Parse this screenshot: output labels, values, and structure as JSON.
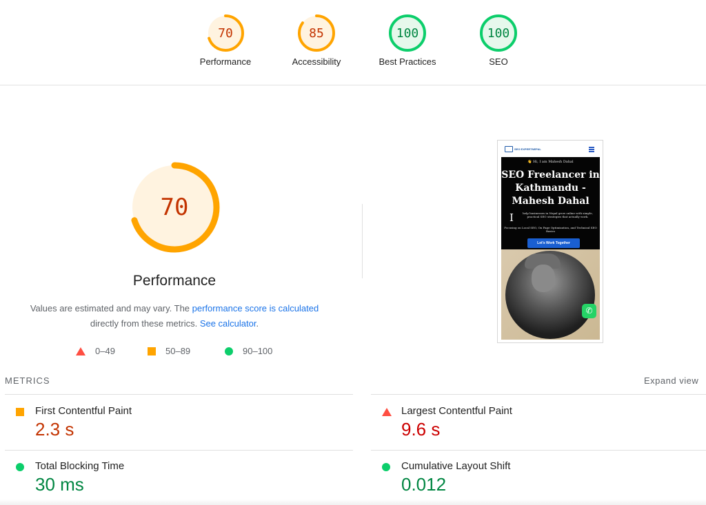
{
  "colors": {
    "average": "#ffa400",
    "average_text": "#c33300",
    "average_bg": "#fff3e0",
    "pass": "#0cce6b",
    "pass_text": "#018642",
    "pass_bg": "#e6f8ec",
    "fail": "#ff4e42",
    "fail_text": "#cc0000",
    "link": "#1a73e8"
  },
  "categories": [
    {
      "label": "Performance",
      "score": "70",
      "score_value": 70,
      "rating": "average"
    },
    {
      "label": "Accessibility",
      "score": "85",
      "score_value": 85,
      "rating": "average"
    },
    {
      "label": "Best Practices",
      "score": "100",
      "score_value": 100,
      "rating": "pass"
    },
    {
      "label": "SEO",
      "score": "100",
      "score_value": 100,
      "rating": "pass"
    }
  ],
  "performance": {
    "score": "70",
    "score_value": 70,
    "title": "Performance",
    "desc_pre": "Values are estimated and may vary. The ",
    "desc_link1": "performance score is calculated",
    "desc_mid": " directly from these metrics. ",
    "desc_link2": "See calculator",
    "desc_post": "."
  },
  "legend": [
    {
      "shape": "triangle-icon",
      "label": "0–49"
    },
    {
      "shape": "square-icon",
      "label": "50–89"
    },
    {
      "shape": "circle-icon",
      "label": "90–100"
    }
  ],
  "screenshot": {
    "logo_text": "SEO EXPERTNEPAL",
    "greeting": "👋 Hi, I am Mahesh Dahal",
    "headline": "SEO Freelancer in Kathmandu - Mahesh Dahal",
    "big_letter": "I",
    "intro": "help businesses in Nepal grow online with simple, practical SEO strategies that actually work.",
    "focus": "Focusing on Local SEO, On Page Optimization, and Technical SEO Basics",
    "cta": "Let's Work Together",
    "whatsapp_icon": "whatsapp-icon"
  },
  "metrics": {
    "heading": "METRICS",
    "expand": "Expand view",
    "items": [
      {
        "name": "First Contentful Paint",
        "value": "2.3 s",
        "rating": "average"
      },
      {
        "name": "Largest Contentful Paint",
        "value": "9.6 s",
        "rating": "fail"
      },
      {
        "name": "Total Blocking Time",
        "value": "30 ms",
        "rating": "pass"
      },
      {
        "name": "Cumulative Layout Shift",
        "value": "0.012",
        "rating": "pass"
      }
    ]
  }
}
